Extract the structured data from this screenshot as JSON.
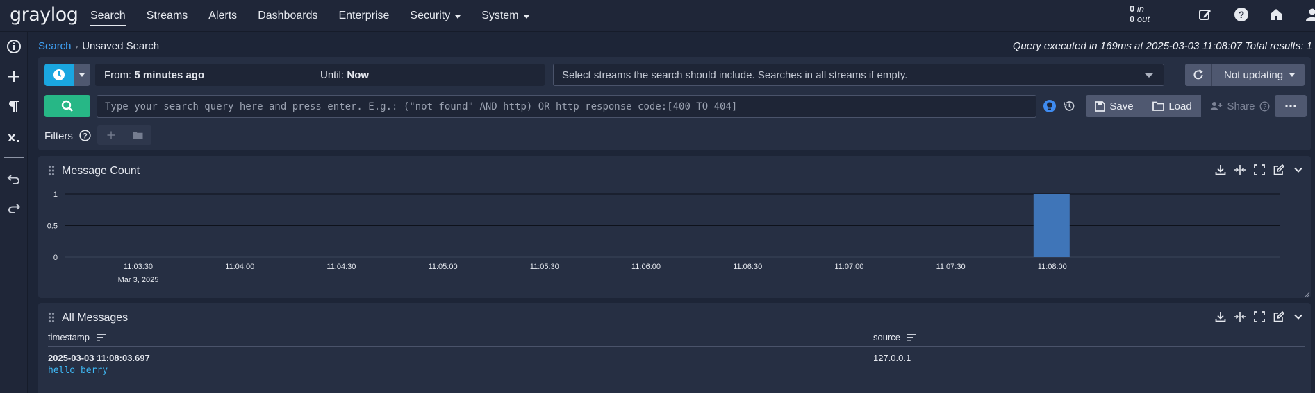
{
  "brand": {
    "logo": "graylog"
  },
  "nav": {
    "items": [
      {
        "label": "Search",
        "active": true,
        "dropdown": false
      },
      {
        "label": "Streams",
        "active": false,
        "dropdown": false
      },
      {
        "label": "Alerts",
        "active": false,
        "dropdown": false
      },
      {
        "label": "Dashboards",
        "active": false,
        "dropdown": false
      },
      {
        "label": "Enterprise",
        "active": false,
        "dropdown": false
      },
      {
        "label": "Security",
        "active": false,
        "dropdown": true
      },
      {
        "label": "System",
        "active": false,
        "dropdown": true
      }
    ],
    "throughput": {
      "in_count": "0",
      "in_label": "in",
      "out_count": "0",
      "out_label": "out"
    },
    "icons": [
      "edit-icon",
      "help-icon",
      "home-icon",
      "user-icon"
    ]
  },
  "sidebar": {
    "icons": [
      "info-icon",
      "plus-icon",
      "paragraph-icon",
      "variable-icon",
      "undo-icon",
      "redo-icon"
    ]
  },
  "breadcrumb": {
    "root": "Search",
    "current": "Unsaved Search"
  },
  "query_info": "Query executed in 169ms at 2025-03-03 11:08:07 Total results: 1",
  "search": {
    "from_label": "From:",
    "from_value": "5 minutes ago",
    "until_label": "Until:",
    "until_value": "Now",
    "streams_placeholder": "Select streams the search should include. Searches in all streams if empty.",
    "refresh_label": "Not updating",
    "query_placeholder": "Type your search query here and press enter. E.g.: (\"not found\" AND http) OR http response code:[400 TO 404]",
    "save_label": "Save",
    "load_label": "Load",
    "share_label": "Share",
    "filters_label": "Filters"
  },
  "widgets": {
    "message_count": {
      "title": "Message Count"
    },
    "all_messages": {
      "title": "All Messages",
      "columns": [
        "timestamp",
        "source"
      ],
      "rows": [
        {
          "timestamp": "2025-03-03 11:08:03.697",
          "message": "hello berry",
          "source": "127.0.0.1"
        }
      ]
    }
  },
  "chart_data": {
    "type": "bar",
    "x": [
      "11:03:30",
      "11:04:00",
      "11:04:30",
      "11:05:00",
      "11:05:30",
      "11:06:00",
      "11:06:30",
      "11:07:00",
      "11:07:30",
      "11:08:00"
    ],
    "x_sublabel": "Mar 3, 2025",
    "y_ticks": [
      "0",
      "0.5",
      "1"
    ],
    "ylim": [
      0,
      1
    ],
    "bars": [
      {
        "x": "11:08:00",
        "value": 1
      }
    ],
    "bar_color": "#3f75b8",
    "grid": true
  }
}
